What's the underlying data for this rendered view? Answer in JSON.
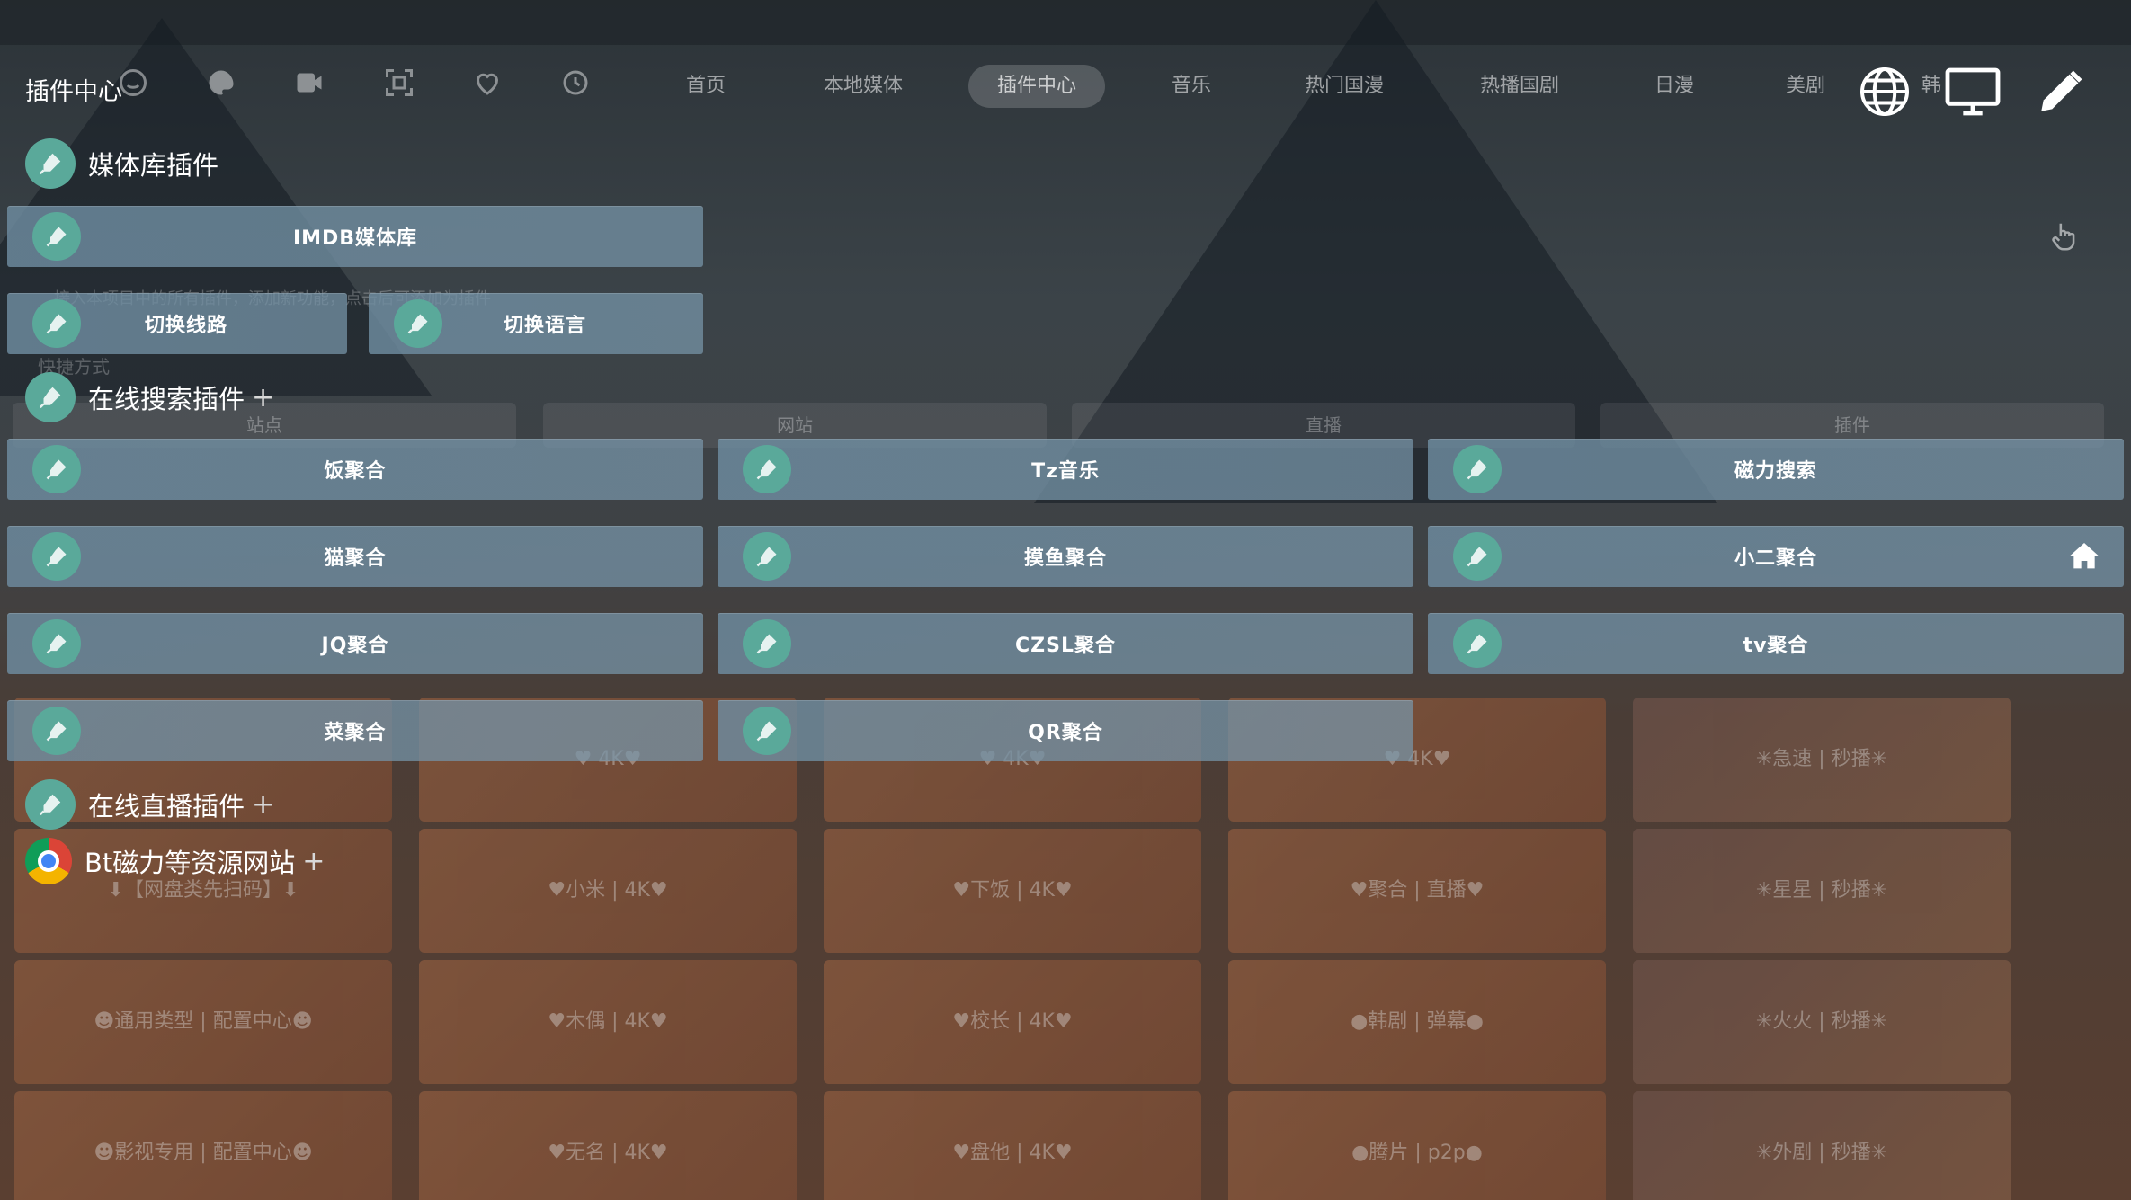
{
  "header": {
    "title": "插件中心"
  },
  "nav": {
    "tabs": [
      {
        "label": "首页",
        "active": false
      },
      {
        "label": "本地媒体",
        "active": false
      },
      {
        "label": "插件中心",
        "active": true
      },
      {
        "label": "音乐",
        "active": false
      },
      {
        "label": "热门国漫",
        "active": false
      },
      {
        "label": "热播国剧",
        "active": false
      },
      {
        "label": "日漫",
        "active": false
      },
      {
        "label": "美剧",
        "active": false
      },
      {
        "label": "韩",
        "active": false
      }
    ],
    "left_icons": [
      "clock-icon",
      "smiley-icon",
      "palette-icon",
      "video-icon",
      "scan-icon",
      "heart-icon",
      "history-icon"
    ]
  },
  "toolbar": {
    "icons": [
      "globe-icon",
      "monitor-icon",
      "edit-icon"
    ]
  },
  "sections": {
    "media": {
      "title": "媒体库插件"
    },
    "search": {
      "title": "在线搜索插件",
      "plus": "+"
    },
    "live": {
      "title": "在线直播插件",
      "plus": "+"
    },
    "bt": {
      "title": "Bt磁力等资源网站",
      "plus": "+"
    }
  },
  "buttons": {
    "imdb": "IMDB媒体库",
    "switch_line": "切换线路",
    "switch_lang": "切换语言",
    "fan": "饭聚合",
    "tz": "Tz音乐",
    "cili": "磁力搜索",
    "mao": "猫聚合",
    "moyu": "摸鱼聚合",
    "xiaoer": "小二聚合",
    "jq": "JQ聚合",
    "czsl": "CZSL聚合",
    "tv": "tv聚合",
    "cai": "菜聚合",
    "qr": "QR聚合"
  },
  "background": {
    "ghost_line": "接入本项目中的所有插件，添加新功能，点击后可添加为插件",
    "shortcut": "快捷方式",
    "pills": [
      "站点",
      "网站",
      "直播",
      "插件"
    ],
    "cards": [
      [
        "",
        "♥ 4K♥",
        "♥ 4K♥",
        "♥ 4K♥",
        "✳急速 | 秒播✳"
      ],
      [
        "⬇【网盘类先扫码】⬇",
        "♥小米 | 4K♥",
        "♥下饭 | 4K♥",
        "♥聚合 | 直播♥",
        "✳星星 | 秒播✳"
      ],
      [
        "☻通用类型 | 配置中心☻",
        "♥木偶 | 4K♥",
        "♥校长 | 4K♥",
        "●韩剧 | 弹幕●",
        "✳火火 | 秒播✳"
      ],
      [
        "☻影视专用 | 配置中心☻",
        "♥无名 | 4K♥",
        "♥盘他 | 4K♥",
        "●腾片 | p2p●",
        "✳外剧 | 秒播✳"
      ]
    ]
  },
  "colors": {
    "plugin_logo": "#5aa99a",
    "button_bg": "#7890a4",
    "active_tab_bg": "#5a6065"
  }
}
